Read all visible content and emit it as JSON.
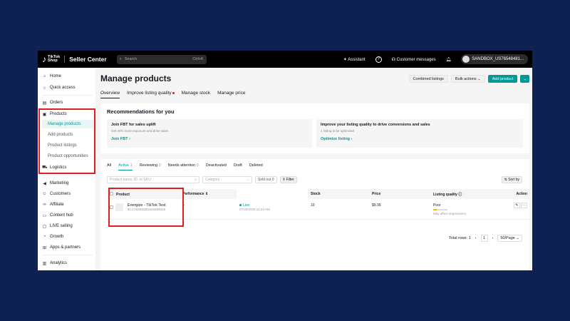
{
  "topbar": {
    "logo_line1": "TikTok",
    "logo_line2": "Shop",
    "brand": "Seller Center",
    "search_placeholder": "Search",
    "search_shortcut": "Ctrl+K",
    "assistant": "Assistant",
    "customer_messages": "Customer messages",
    "account": "SANDBOX_US76548481..."
  },
  "sidebar": {
    "home": "Home",
    "quick_access": "Quick access",
    "orders": "Orders",
    "products": "Products",
    "manage_products": "Manage products",
    "add_products": "Add products",
    "product_listings": "Product listings",
    "product_opportunities": "Product opportunities",
    "logistics": "Logistics",
    "marketing": "Marketing",
    "customers": "Customers",
    "affiliate": "Affiliate",
    "content_hub": "Content hub",
    "live_selling": "LIVE selling",
    "growth": "Growth",
    "apps_partners": "Apps & partners",
    "analytics": "Analytics"
  },
  "header": {
    "title": "Manage products",
    "combined_listings": "Combined listings",
    "bulk_actions": "Bulk actions",
    "add_product": "Add product"
  },
  "tabs": [
    "Overview",
    "Improve listing quality",
    "Manage stock",
    "Manage price"
  ],
  "recommendations": {
    "title": "Recommendations for you",
    "card1_title": "Join FBT for sales uplift",
    "card1_sub": "Get 30% more exposure and drive sales",
    "card1_link": "Join FBT",
    "card2_title": "Improve your listing quality to drive conversions and sales",
    "card2_sub": "1 listing to be optimized",
    "card2_link": "Optimize listing"
  },
  "status_tabs": [
    {
      "label": "All",
      "count": ""
    },
    {
      "label": "Active",
      "count": "1"
    },
    {
      "label": "Reviewing",
      "count": "0"
    },
    {
      "label": "Needs attention",
      "count": "0"
    },
    {
      "label": "Deactivated",
      "count": ""
    },
    {
      "label": "Draft",
      "count": ""
    },
    {
      "label": "Deleted",
      "count": ""
    }
  ],
  "filters": {
    "search_placeholder": "Product name, ID, or SKU",
    "category_placeholder": "Category",
    "sold_out": "Sold out",
    "sold_out_count": "0",
    "filter": "Filter",
    "sort_by": "Sort by"
  },
  "table": {
    "headers": [
      "Product",
      "Performance",
      "",
      "Stock",
      "Price",
      "Listing quality",
      "Action"
    ],
    "row": {
      "name": "Energize - TikTok Test",
      "id": "ID:1732508381646655616",
      "performance": "--",
      "status": "Live",
      "date": "07/30/2026 12:43 AM",
      "stock": "10",
      "price": "$9.99",
      "quality": "Poor",
      "quality_note": "May affect impressions",
      "quality_level": 0.25
    }
  },
  "pagination": {
    "total": "Total rows: 1",
    "page": "1",
    "per_page": "50/Page"
  }
}
